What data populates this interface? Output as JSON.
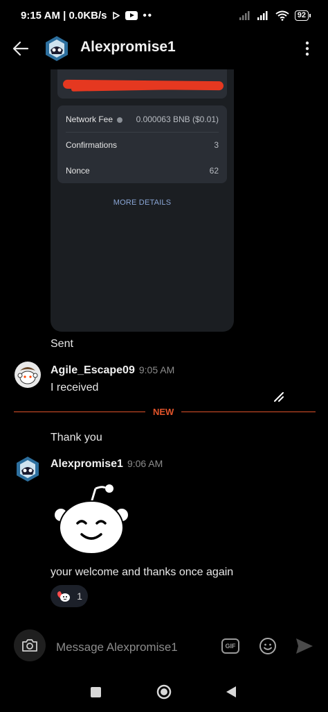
{
  "status_bar": {
    "time_speed": "9:15 AM | 0.0KB/s",
    "battery": "92"
  },
  "header": {
    "title": "Alexpromise1"
  },
  "transaction_card": {
    "rows": [
      {
        "label": "Network Fee",
        "value": "0.000063 BNB ($0.01)"
      },
      {
        "label": "Confirmations",
        "value": "3"
      },
      {
        "label": "Nonce",
        "value": "62"
      }
    ],
    "more_details": "MORE DETAILS"
  },
  "messages": {
    "sent_label": "Sent",
    "agile": {
      "username": "Agile_Escape09",
      "time": "9:05 AM",
      "text": "I received"
    },
    "new_divider": "NEW",
    "thank_you": "Thank you",
    "alex": {
      "username": "Alexpromise1",
      "time": "9:06 AM",
      "text": "your welcome and thanks once again",
      "reaction_count": "1"
    }
  },
  "composer": {
    "placeholder": "Message Alexpromise1",
    "gif_label": "GIF"
  },
  "colors": {
    "background": "#000000",
    "accent_new": "#e0532a",
    "link": "#8aa6d6",
    "redaction": "#e53820"
  }
}
